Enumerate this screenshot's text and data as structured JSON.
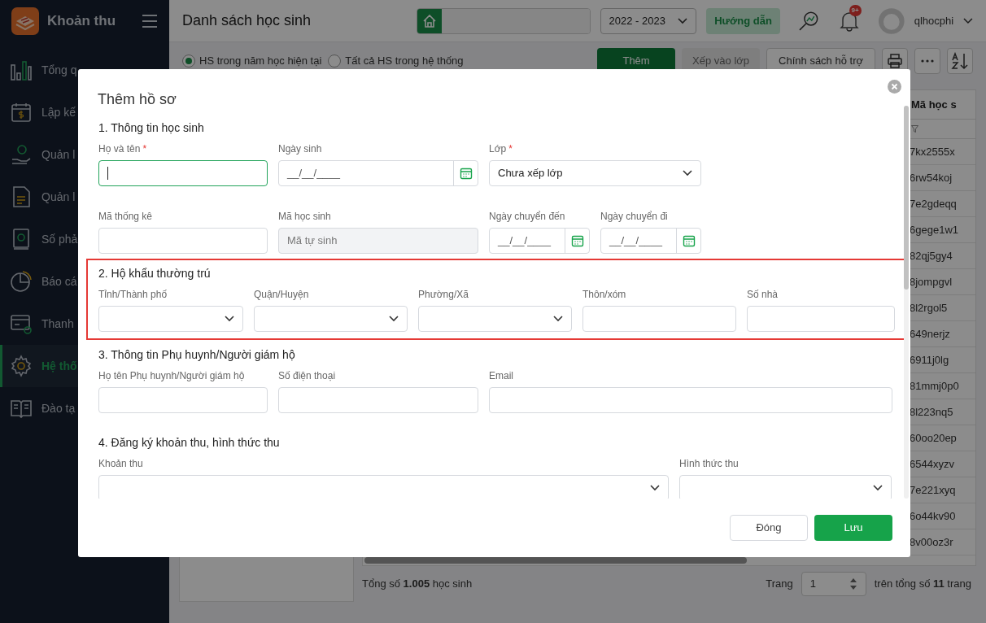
{
  "app": {
    "name": "Khoản thu"
  },
  "sidebar": {
    "items": [
      {
        "label": "Tổng q",
        "selected": false
      },
      {
        "label": "Lập kế",
        "selected": false
      },
      {
        "label": "Quản l",
        "selected": false
      },
      {
        "label": "Quản l",
        "selected": false
      },
      {
        "label": "Số phả",
        "selected": false
      },
      {
        "label": "Báo cá",
        "selected": false
      },
      {
        "label": "Thanh",
        "selected": false
      },
      {
        "label": "Hệ thố",
        "selected": true
      },
      {
        "label": "Đào tạ",
        "selected": false
      }
    ]
  },
  "header": {
    "title": "Danh sách học sinh",
    "year": "2022 - 2023",
    "guide": "Hướng dẫn",
    "badge": "9+",
    "user": "qlhocphi"
  },
  "toolbar": {
    "radios": [
      {
        "label": "HS trong năm học hiện tại",
        "selected": true
      },
      {
        "label": "Tất cả HS trong hệ thống",
        "selected": false
      }
    ],
    "buttons": [
      {
        "label": "Thêm",
        "kind": "primary"
      },
      {
        "label": "Xếp vào lớp",
        "kind": "disabled"
      },
      {
        "label": "Chính sách hỗ trợ",
        "kind": "outline"
      }
    ]
  },
  "table": {
    "column": "Mã học s",
    "rows": [
      "7kx2555x",
      "6rw54koj",
      "7e2gdeqq",
      "6gege1w1",
      "82qj5gy4",
      "8jompgvl",
      "8l2rgol5",
      "649nerjz",
      "6911j0lg",
      "81mmj0p0",
      "8l223nq5",
      "60oo20ep",
      "6544xyzv",
      "7e221xyq",
      "6o44kv90",
      "8v00oz3r"
    ]
  },
  "footer": {
    "total": "Tổng số **1.005** học sinh",
    "page_label": "Trang",
    "page": "1",
    "pages": "trên tổng số **11** trang"
  },
  "dialog": {
    "title": "Thêm hồ sơ",
    "sections": [
      {
        "title": "1. Thông tin học sinh",
        "highlighted": false,
        "rows": [
          [
            {
              "label": "Họ và tên",
              "required_mark": "*",
              "kind": "text",
              "focused": true
            },
            {
              "label": "Ngày sinh",
              "kind": "date",
              "placeholder": "__/__/____"
            },
            {
              "label": "Lớp",
              "required_mark": "*",
              "kind": "select",
              "value": "Chưa xếp lớp"
            }
          ],
          [
            {
              "label": "Mã thống kê",
              "kind": "text",
              "focused": false
            },
            {
              "label": "Mã học sinh",
              "kind": "readonly",
              "placeholder": "Mã tự sinh"
            },
            {
              "label": "Ngày chuyển đến",
              "kind": "date",
              "placeholder": "__/__/____"
            },
            {
              "label": "Ngày chuyển đi",
              "kind": "date",
              "placeholder": "__/__/____"
            }
          ]
        ]
      },
      {
        "title": "2. Hộ khẩu thường trú",
        "highlighted": true,
        "rows": [
          [
            {
              "label": "Tỉnh/Thành phố",
              "kind": "select"
            },
            {
              "label": "Quận/Huyện",
              "kind": "select"
            },
            {
              "label": "Phường/Xã",
              "kind": "select"
            },
            {
              "label": "Thôn/xóm",
              "kind": "text",
              "focused": false
            },
            {
              "label": "Số nhà",
              "kind": "text",
              "focused": false
            }
          ]
        ]
      },
      {
        "title": "3. Thông tin Phụ huynh/Người giám hộ",
        "highlighted": false,
        "rows": [
          [
            {
              "label": "Họ tên Phụ huynh/Người giám hộ",
              "kind": "text",
              "focused": false
            },
            {
              "label": "Số điện thoại",
              "kind": "text",
              "focused": false
            },
            {
              "label": "Email",
              "kind": "text",
              "focused": false
            }
          ]
        ]
      },
      {
        "title": "4. Đăng ký khoản thu, hình thức thu",
        "highlighted": false,
        "rows": [
          [
            {
              "label": "Khoản thu",
              "kind": "select"
            },
            {
              "label": "Hình thức thu",
              "kind": "select"
            }
          ]
        ]
      }
    ],
    "buttons": [
      {
        "label": "Đóng",
        "kind": "outline"
      },
      {
        "label": "Lưu",
        "kind": "primary"
      }
    ]
  }
}
